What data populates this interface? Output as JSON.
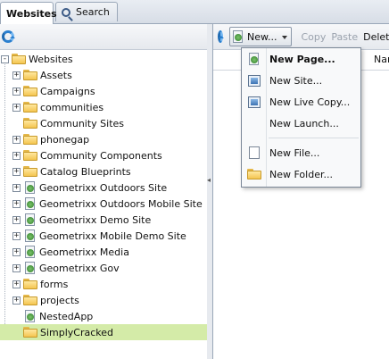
{
  "tabs": [
    {
      "label": "Websites",
      "active": true
    },
    {
      "label": "Search",
      "active": false,
      "icon": "magnifier-icon"
    }
  ],
  "tree": [
    {
      "label": "Websites",
      "icon": "folder",
      "expander": "-",
      "level": 0
    },
    {
      "label": "Assets",
      "icon": "folder",
      "expander": "+",
      "level": 1
    },
    {
      "label": "Campaigns",
      "icon": "folder",
      "expander": "+",
      "level": 1
    },
    {
      "label": "communities",
      "icon": "folder",
      "expander": "+",
      "level": 1
    },
    {
      "label": "Community Sites",
      "icon": "folder",
      "expander": "",
      "level": 1
    },
    {
      "label": "phonegap",
      "icon": "folder",
      "expander": "+",
      "level": 1
    },
    {
      "label": "Community Components",
      "icon": "folder",
      "expander": "+",
      "level": 1
    },
    {
      "label": "Catalog Blueprints",
      "icon": "folder",
      "expander": "+",
      "level": 1
    },
    {
      "label": "Geometrixx Outdoors Site",
      "icon": "page",
      "expander": "+",
      "level": 1
    },
    {
      "label": "Geometrixx Outdoors Mobile Site",
      "icon": "page",
      "expander": "+",
      "level": 1
    },
    {
      "label": "Geometrixx Demo Site",
      "icon": "page",
      "expander": "+",
      "level": 1
    },
    {
      "label": "Geometrixx Mobile Demo Site",
      "icon": "page",
      "expander": "+",
      "level": 1
    },
    {
      "label": "Geometrixx Media",
      "icon": "page",
      "expander": "+",
      "level": 1
    },
    {
      "label": "Geometrixx Gov",
      "icon": "page",
      "expander": "+",
      "level": 1
    },
    {
      "label": "forms",
      "icon": "folder",
      "expander": "+",
      "level": 1
    },
    {
      "label": "projects",
      "icon": "folder",
      "expander": "+",
      "level": 1
    },
    {
      "label": "NestedApp",
      "icon": "page",
      "expander": "",
      "level": 1
    },
    {
      "label": "SimplyCracked",
      "icon": "folder",
      "expander": "",
      "level": 1,
      "selected": true
    }
  ],
  "toolbar": {
    "new_label": "New...",
    "copy_label": "Copy",
    "paste_label": "Paste",
    "delete_label": "Delet"
  },
  "grid": {
    "name_header": "Nar"
  },
  "menu": [
    {
      "label": "New Page...",
      "icon": "page-icon",
      "bold": true
    },
    {
      "label": "New Site...",
      "icon": "site-icon"
    },
    {
      "label": "New Live Copy...",
      "icon": "site-icon"
    },
    {
      "label": "New Launch...",
      "icon": ""
    },
    {
      "separator": true
    },
    {
      "label": "New File...",
      "icon": "file-icon"
    },
    {
      "label": "New Folder...",
      "icon": "folder-icon"
    }
  ],
  "colors": {
    "selected_row": "#d4eba8",
    "accent": "#2a7fcf"
  }
}
